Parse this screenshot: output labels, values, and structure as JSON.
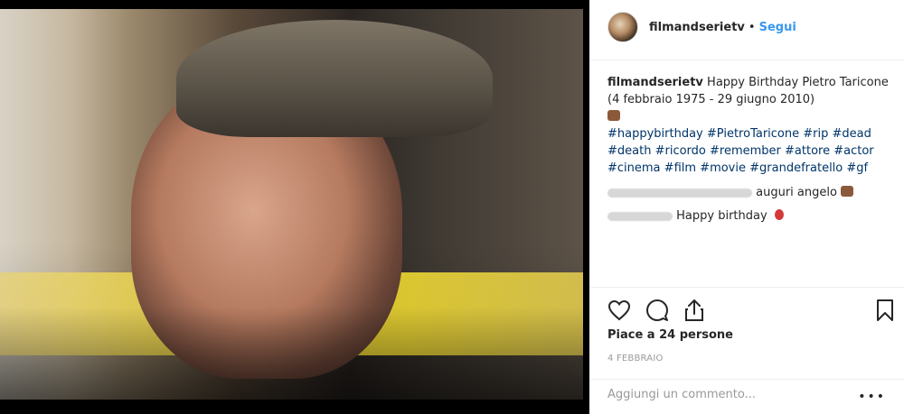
{
  "header": {
    "username": "filmandserietv",
    "separator": "•",
    "follow_label": "Segui"
  },
  "caption": {
    "username": "filmandserietv",
    "text": "Happy Birthday Pietro Taricone (4 febbraio 1975 - 29 giugno 2010)",
    "emoji": "cake",
    "hashtags": [
      "#happybirthday",
      "#PietroTaricone",
      "#rip",
      "#dead",
      "#death",
      "#ricordo",
      "#remember",
      "#attore",
      "#actor",
      "#cinema",
      "#film",
      "#movie",
      "#grandefratello",
      "#gf"
    ]
  },
  "comments": [
    {
      "text": "auguri angelo",
      "emoji": "cake"
    },
    {
      "text": "Happy birthday",
      "emoji": "balloon"
    }
  ],
  "icons": {
    "like": "heart-icon",
    "comment": "comment-icon",
    "share": "share-icon",
    "save": "bookmark-icon"
  },
  "likes_text": "Piace a 24 persone",
  "date_text": "4 FEBBRAIO",
  "add_comment_placeholder": "Aggiungi un commento...",
  "more_label": "•••",
  "colors": {
    "link": "#3897f0",
    "hashtag": "#003569",
    "muted": "#999999",
    "border": "#efefef"
  }
}
